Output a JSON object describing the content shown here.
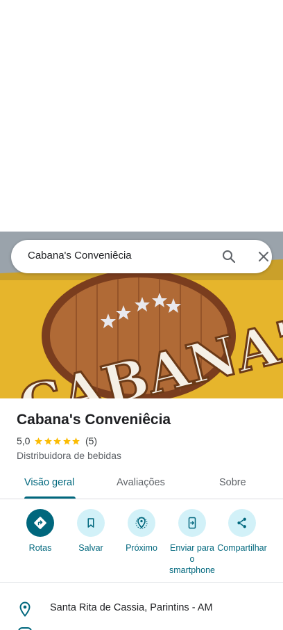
{
  "search": {
    "query": "Cabana's Conveniêcia"
  },
  "hero": {
    "sign_text": "CABANA'S"
  },
  "place": {
    "name": "Cabana's Conveniêcia",
    "rating": "5,0",
    "stars": 5,
    "review_count": "(5)",
    "category": "Distribuidora de bebidas"
  },
  "tabs": [
    {
      "label": "Visão geral",
      "selected": true
    },
    {
      "label": "Avaliações",
      "selected": false
    },
    {
      "label": "Sobre",
      "selected": false
    }
  ],
  "actions": [
    {
      "label": "Rotas",
      "icon": "directions-icon"
    },
    {
      "label": "Salvar",
      "icon": "bookmark-icon"
    },
    {
      "label": "Próximo",
      "icon": "nearby-icon"
    },
    {
      "label": "Enviar para o smartphone",
      "icon": "send-to-phone-icon"
    },
    {
      "label": "Compartilhar",
      "icon": "share-icon"
    }
  ],
  "address": {
    "text": "Santa Rita de Cassia, Parintins - AM"
  },
  "colors": {
    "accent": "#00677d",
    "accent_light": "#d2f1f8",
    "star": "#fbbc04",
    "sign_yellow": "#e8b82a",
    "sign_brown": "#7a3d1e"
  }
}
